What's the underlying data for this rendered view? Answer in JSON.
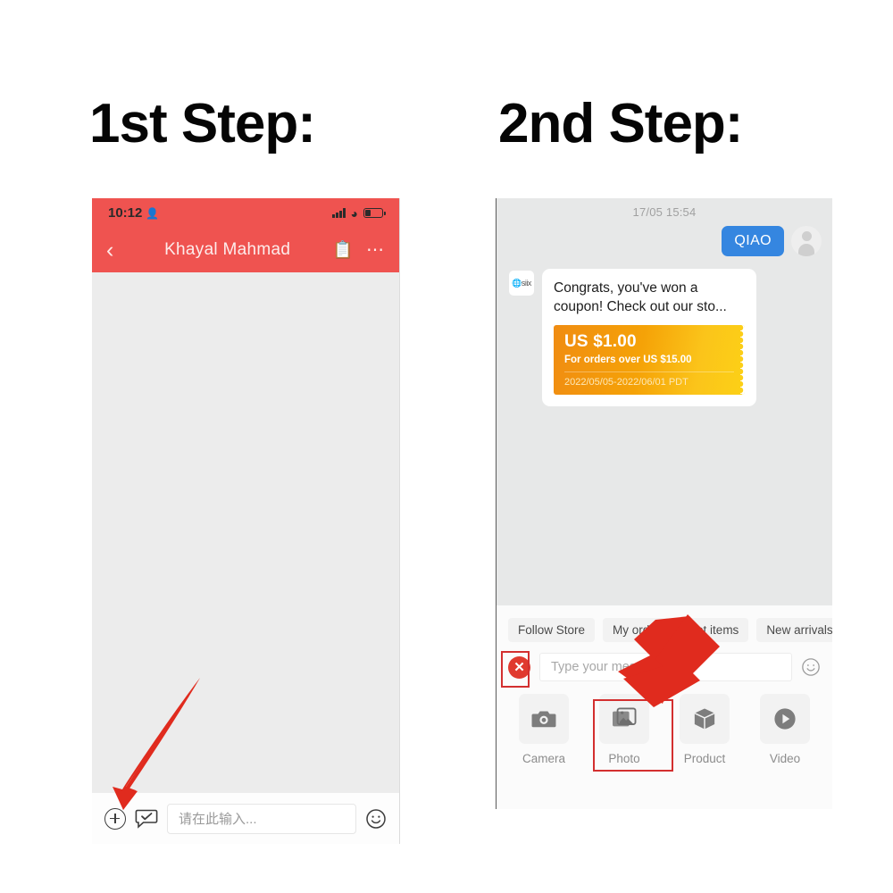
{
  "steps": {
    "first": "1st Step:",
    "second": "2nd Step:"
  },
  "colors": {
    "header_red": "#ef5350",
    "accent_blue": "#3586e0",
    "coupon_orange": "#f5a207",
    "coupon_yellow": "#fcd116",
    "arrow_red": "#e02b1e",
    "highlight_red": "#d32f2f"
  },
  "panel1": {
    "status": {
      "time": "10:12",
      "person_icon": "person-icon",
      "signal_icon": "signal-bars-icon",
      "wifi_icon": "wifi-icon",
      "battery_icon": "battery-low-icon"
    },
    "nav": {
      "back_icon": "chevron-left-icon",
      "title": "Khayal Mahmad",
      "clipboard_icon": "clipboard-icon",
      "more_icon": "more-dots-icon"
    },
    "inputbar": {
      "plus_icon": "plus-circle-icon",
      "quickreply_icon": "chat-check-icon",
      "placeholder": "请在此输入...",
      "value": "",
      "emoji_icon": "smiley-icon"
    }
  },
  "panel2": {
    "chat": {
      "timestamp": "17/05 15:54",
      "outgoing_message": "QIAO",
      "avatar_icon": "user-avatar-icon",
      "store_avatar_icon": "store-logo-icon",
      "incoming_message": "Congrats, you've won a coupon! Check out our sto...",
      "coupon": {
        "amount": "US $1.00",
        "condition": "For orders over US $15.00",
        "validity": "2022/05/05-2022/06/01 PDT"
      }
    },
    "chips": [
      {
        "label": "Follow Store"
      },
      {
        "label": "My order"
      },
      {
        "label": "Hot items"
      },
      {
        "label": "New arrivals"
      }
    ],
    "inputbar": {
      "close_icon": "close-circle-icon",
      "placeholder": "Type your message...",
      "value": "",
      "emoji_icon": "smiley-icon"
    },
    "attachments": [
      {
        "label": "Camera",
        "icon": "camera-icon"
      },
      {
        "label": "Photo",
        "icon": "photo-icon"
      },
      {
        "label": "Product",
        "icon": "product-box-icon"
      },
      {
        "label": "Video",
        "icon": "video-play-icon"
      }
    ]
  }
}
